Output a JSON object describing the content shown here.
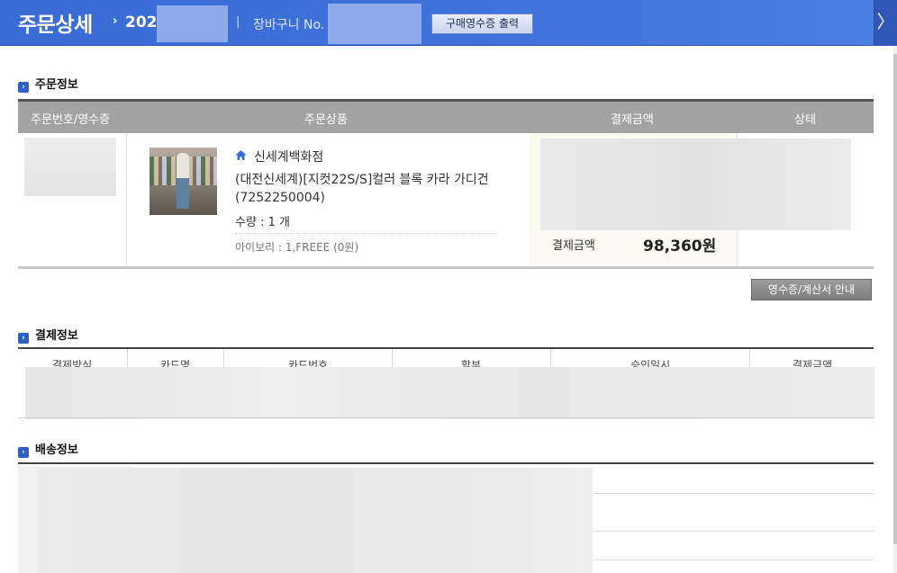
{
  "header": {
    "title": "주문상세",
    "order_no_prefix": "202",
    "separator": "|",
    "cart_label": "장바구니 No.",
    "receipt_print_button": "구매영수증 출력",
    "arrow_glyph": "›",
    "close_glyph": "〉"
  },
  "order_section": {
    "heading": "주문정보",
    "columns": [
      "주문번호/영수증",
      "주문상품",
      "결제금액",
      "상태"
    ],
    "item": {
      "store": "신세계백화점",
      "product_name": "(대전신세계)[지컷22S/S]컬러 블록 카라 가디건(7252250004)",
      "quantity": "수량 : 1 개",
      "option": "아이보리 : 1,FREEE (0원)",
      "payment_label": "결제금액",
      "payment_amount": "98,360원"
    },
    "guide_button": "영수증/계산서 안내"
  },
  "payment_section": {
    "heading": "결제정보",
    "columns": [
      "결제방식",
      "카드명",
      "카드번호",
      "할부",
      "승인일시",
      "결제금액"
    ]
  },
  "delivery_section": {
    "heading": "배송정보"
  },
  "colors": {
    "header_blue": "#3f73dc",
    "table_header_gray": "#a3a3a3",
    "payment_cell_bg": "#fcfbf1"
  }
}
